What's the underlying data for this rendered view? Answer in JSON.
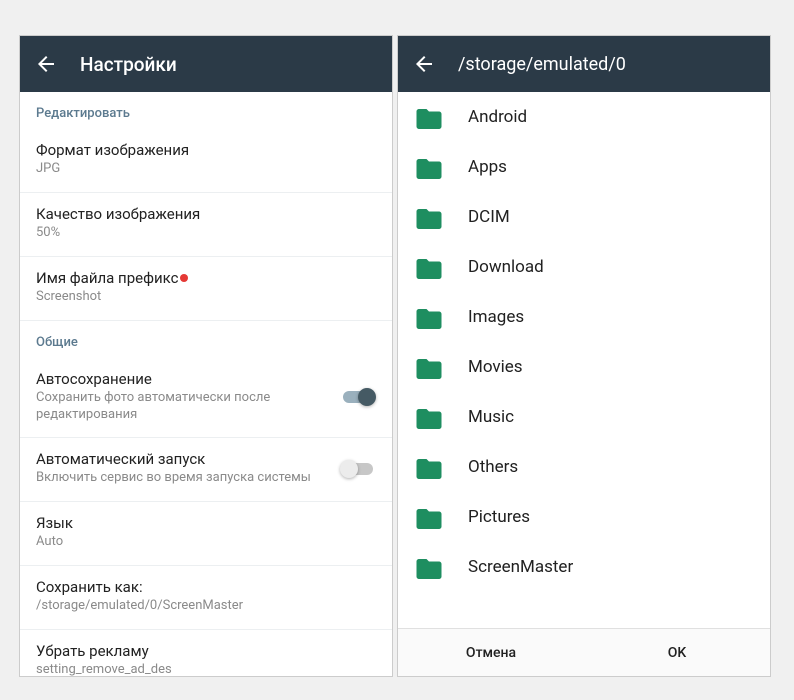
{
  "settings": {
    "title": "Настройки",
    "sections": {
      "edit_header": "Редактировать",
      "general_header": "Общие"
    },
    "image_format": {
      "title": "Формат изображения",
      "value": "JPG"
    },
    "image_quality": {
      "title": "Качество изображения",
      "value": "50%"
    },
    "file_prefix": {
      "title": "Имя файла префикс",
      "value": "Screenshot"
    },
    "autosave": {
      "title": "Автосохранение",
      "sub": "Сохранить фото автоматически после редактирования"
    },
    "autostart": {
      "title": "Автоматический запуск",
      "sub": "Включить сервис во время запуска системы"
    },
    "language": {
      "title": "Язык",
      "value": "Auto"
    },
    "save_as": {
      "title": "Сохранить как:",
      "value": "/storage/emulated/0/ScreenMaster"
    },
    "remove_ads": {
      "title": "Убрать рекламу",
      "value": "setting_remove_ad_des"
    }
  },
  "picker": {
    "path": "/storage/emulated/0",
    "folders": [
      "Android",
      "Apps",
      "DCIM",
      "Download",
      "Images",
      "Movies",
      "Music",
      "Others",
      "Pictures",
      "ScreenMaster"
    ],
    "cancel": "Отмена",
    "ok": "OK"
  },
  "colors": {
    "folder": "#1e8e60"
  }
}
